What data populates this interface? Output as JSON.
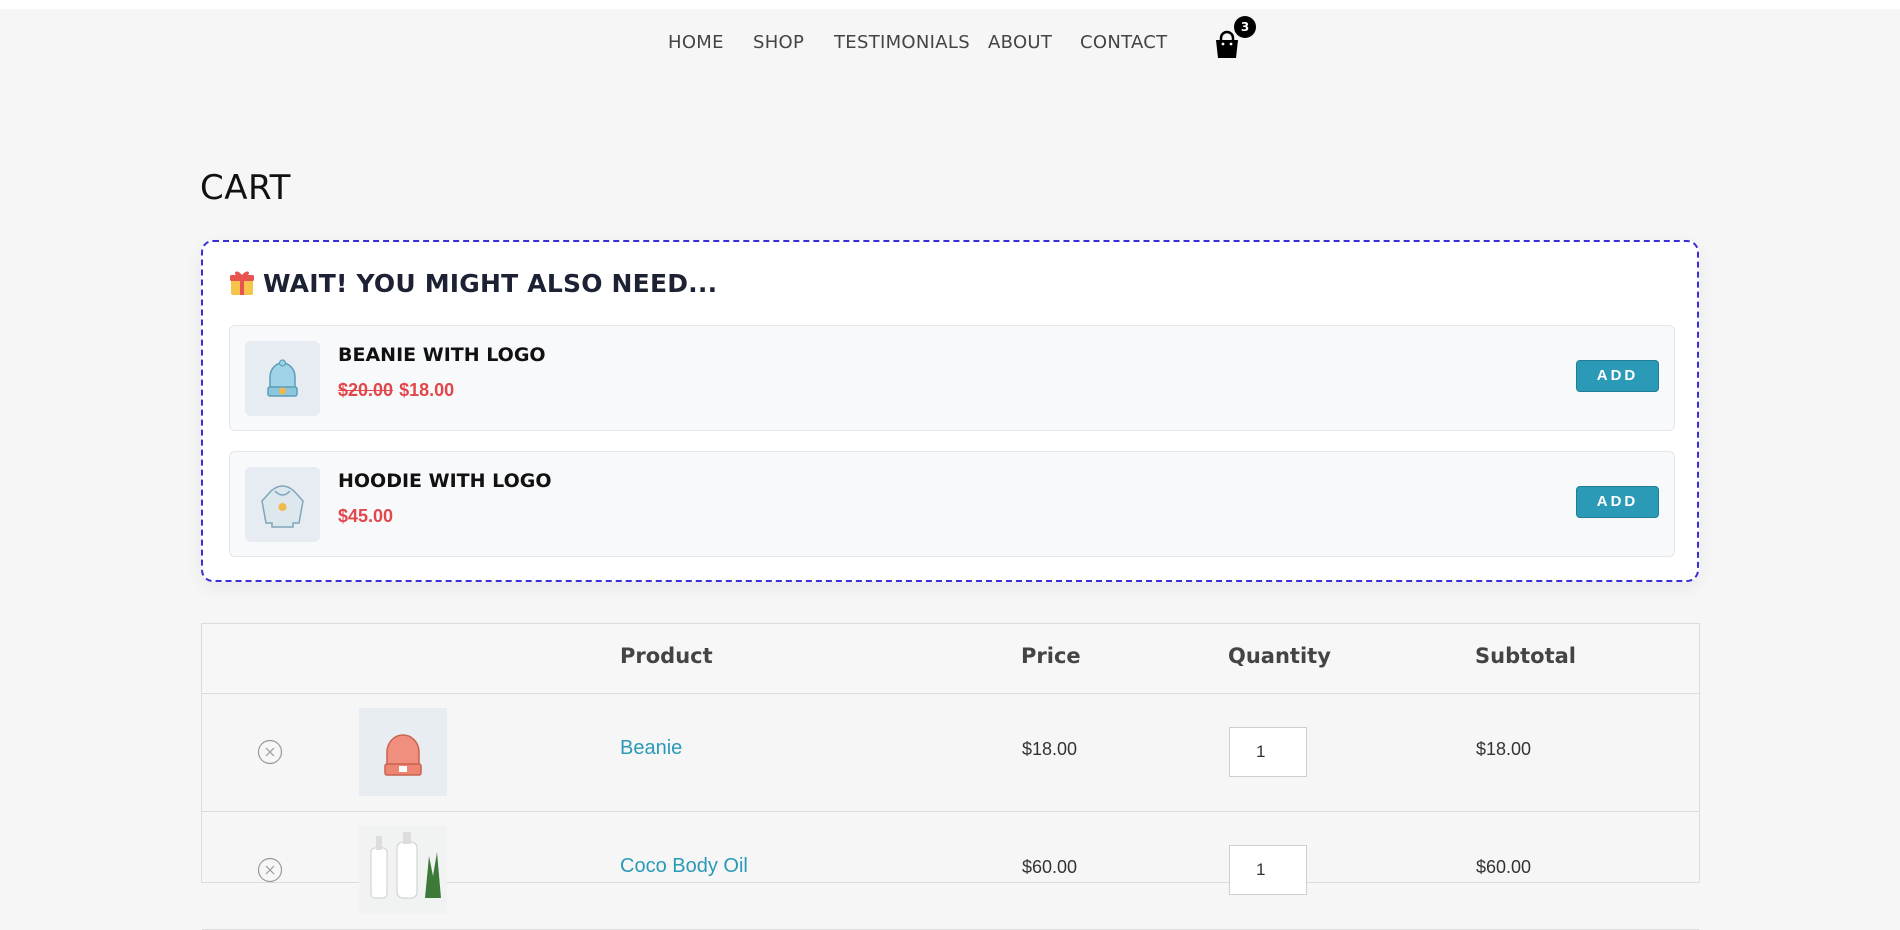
{
  "nav": {
    "items": [
      {
        "label": "HOME"
      },
      {
        "label": "SHOP"
      },
      {
        "label": "TESTIMONIALS"
      },
      {
        "label": "ABOUT"
      },
      {
        "label": "CONTACT"
      }
    ],
    "cart_count": "3"
  },
  "page": {
    "title": "CART"
  },
  "upsell": {
    "heading": "WAIT! YOU MIGHT ALSO NEED...",
    "items": [
      {
        "name": "BEANIE WITH LOGO",
        "old_price": "$20.00",
        "price": "$18.00",
        "button": "ADD"
      },
      {
        "name": "HOODIE WITH LOGO",
        "old_price": "",
        "price": "$45.00",
        "button": "ADD"
      }
    ]
  },
  "cart": {
    "headers": {
      "product": "Product",
      "price": "Price",
      "quantity": "Quantity",
      "subtotal": "Subtotal"
    },
    "rows": [
      {
        "name": "Beanie",
        "price": "$18.00",
        "quantity": "1",
        "subtotal": "$18.00"
      },
      {
        "name": "Coco Body Oil",
        "price": "$60.00",
        "quantity": "1",
        "subtotal": "$60.00"
      }
    ]
  },
  "colors": {
    "accent": "#2a9ab6",
    "sale": "#e2474b",
    "upsell_border": "#3a2fd6"
  }
}
